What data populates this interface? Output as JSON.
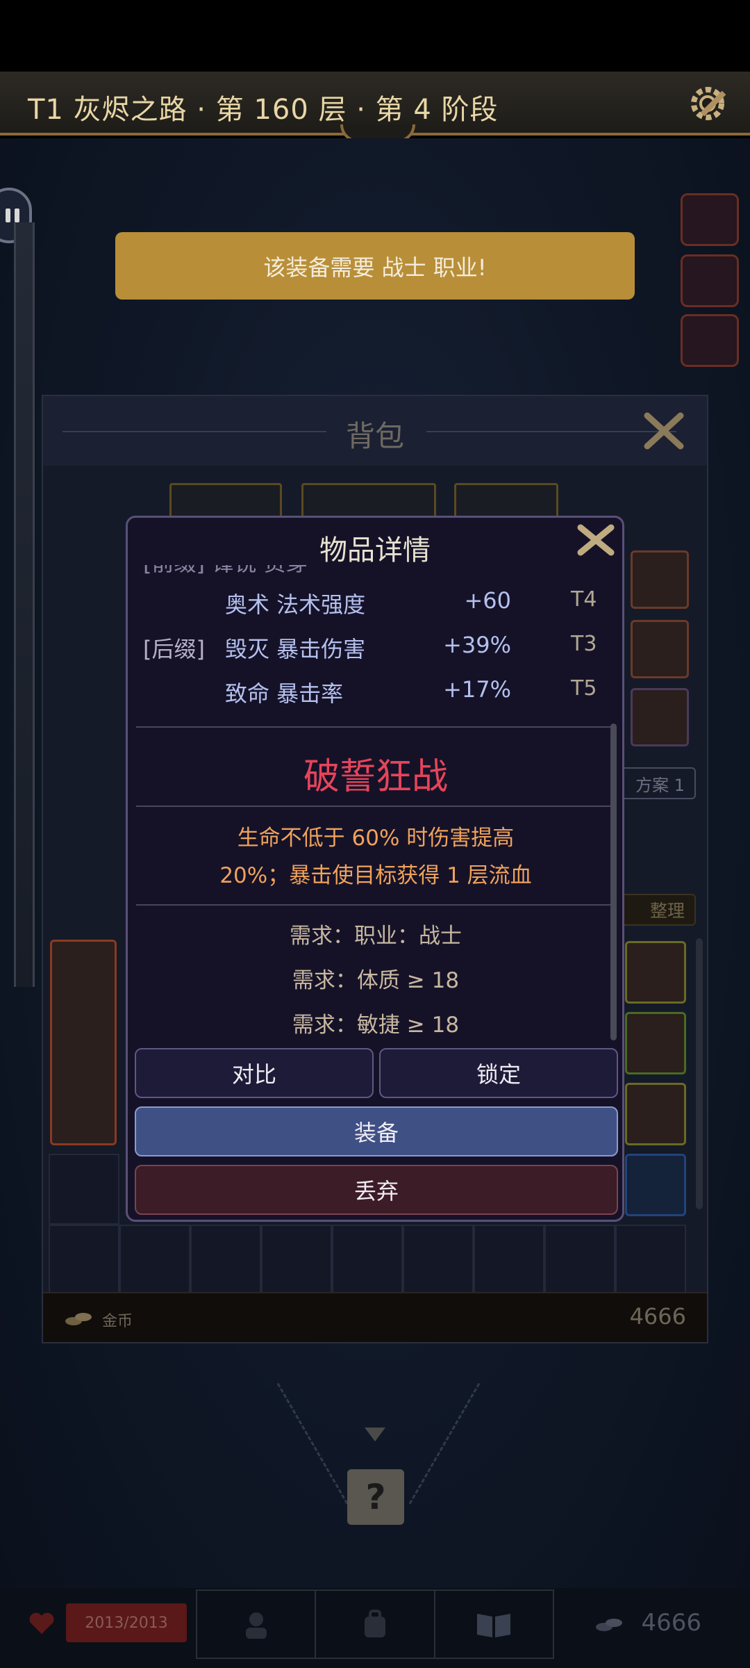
{
  "header": {
    "title": "T1 灰烬之路 · 第 160 层 · 第 4 阶段"
  },
  "notice": {
    "text": "该装备需要 战士 职业!"
  },
  "backpack": {
    "title": "背包",
    "tab_fragment": "方案 1",
    "sort_label": "整理",
    "gold_label": "金币",
    "gold_value": "4666"
  },
  "bottom_nav": {
    "hp": "2013/2013",
    "gold": "4666"
  },
  "item_detail": {
    "title": "物品详情",
    "partial_top_row": "[前缀]  锋锐 贯穿",
    "affixes": [
      {
        "tag": "",
        "name": "奥术 法术强度",
        "value": "+60",
        "tier": "T4"
      },
      {
        "tag": "[后缀]",
        "name": "毁灭 暴击伤害",
        "value": "+39%",
        "tier": "T3"
      },
      {
        "tag": "",
        "name": "致命 暴击率",
        "value": "+17%",
        "tier": "T5"
      }
    ],
    "legendary_name": "破誓狂战",
    "legendary_desc": [
      "生命不低于 60% 时伤害提高",
      "20%；暴击使目标获得 1 层流血"
    ],
    "requirements": [
      "需求：职业：战士",
      "需求：体质 ≥ 18",
      "需求：敏捷 ≥ 18"
    ],
    "buttons": {
      "compare": "对比",
      "lock": "锁定",
      "equip": "装备",
      "drop": "丢弃"
    }
  },
  "colors": {
    "notice_bg": "#b88f38",
    "legendary_name": "#e6445a",
    "legendary_desc": "#f0a25a",
    "affix_text": "#b4c0ee",
    "equip_button": "#3e5084",
    "drop_button": "#3c1c26"
  }
}
